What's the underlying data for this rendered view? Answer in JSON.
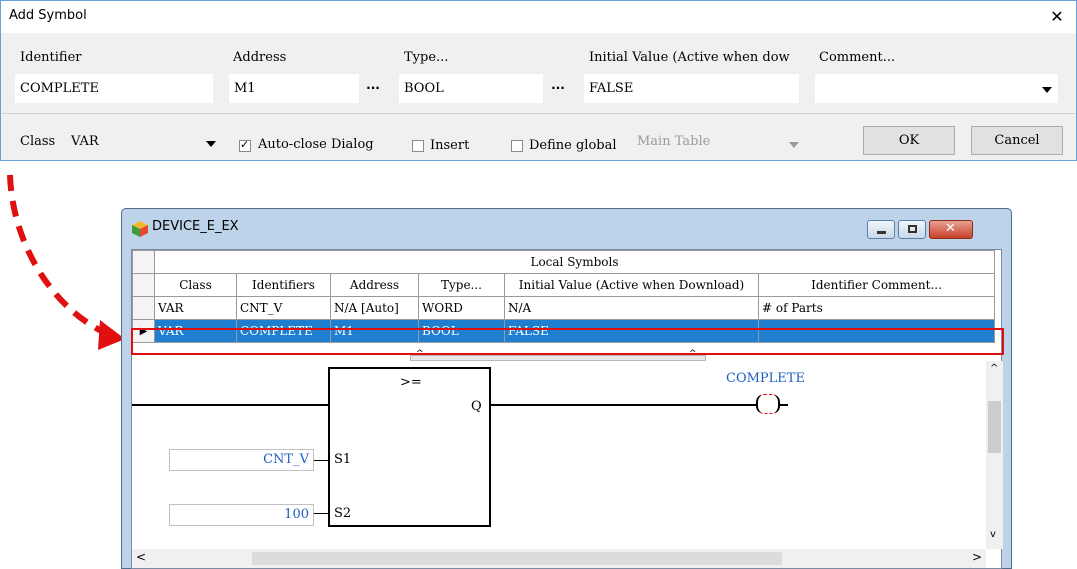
{
  "dialog": {
    "title": "Add Symbol",
    "close_glyph": "✕",
    "fields": {
      "identifier": {
        "label": "Identifier",
        "value": "COMPLETE"
      },
      "address": {
        "label": "Address",
        "value": "M1"
      },
      "type": {
        "label": "Type...",
        "value": "BOOL"
      },
      "initial_value": {
        "label": "Initial Value (Active when dow",
        "value": "FALSE"
      },
      "comment": {
        "label": "Comment...",
        "value": ""
      }
    },
    "ellipsis": "···",
    "class_label": "Class",
    "class_value": "VAR",
    "auto_close": {
      "label": "Auto-close Dialog",
      "checked": true
    },
    "insert": {
      "label": "Insert",
      "checked": false
    },
    "define_global": {
      "label": "Define global",
      "checked": false
    },
    "main_table": "Main Table",
    "ok": "OK",
    "cancel": "Cancel",
    "check_glyph": "✓"
  },
  "window": {
    "title": "DEVICE_E_EX",
    "section_title": "Local Symbols",
    "columns": [
      "Class",
      "Identifiers",
      "Address",
      "Type...",
      "Initial Value (Active when Download)",
      "Identifier Comment..."
    ],
    "rows": [
      {
        "class": "VAR",
        "identifier": "CNT_V",
        "address": "N/A [Auto]",
        "type": "WORD",
        "initial": "N/A",
        "comment": "# of Parts",
        "selected": false
      },
      {
        "class": "VAR",
        "identifier": "COMPLETE",
        "address": "M1",
        "type": "BOOL",
        "initial": "FALSE",
        "comment": "",
        "selected": true
      }
    ],
    "row_marker": "▶",
    "ladder": {
      "block_op": ">=",
      "out_pin": "Q",
      "in_pin1": "S1",
      "in_pin2": "S2",
      "input1": "CNT_V",
      "input2": "100",
      "coil_label": "COMPLETE"
    }
  },
  "colors": {
    "selection": "#1e7fd0",
    "highlight_border": "#e01010",
    "arrow": "#e01010",
    "var_text": "#1f5fbf"
  }
}
